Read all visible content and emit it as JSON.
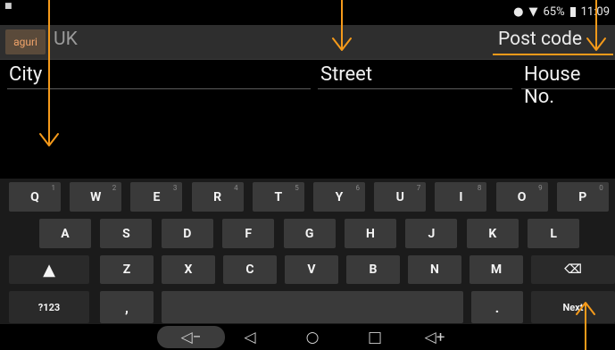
{
  "status": {
    "battery_percent": "65%",
    "time": "11:09"
  },
  "header": {
    "logo_text": "aguri",
    "country": "UK",
    "postcode_label": "Post code"
  },
  "fields": [
    {
      "label": "City"
    },
    {
      "label": "Street"
    },
    {
      "label": "House No."
    }
  ],
  "keyboard": {
    "row1": [
      {
        "label": "Q",
        "hint": "1"
      },
      {
        "label": "W",
        "hint": "2"
      },
      {
        "label": "E",
        "hint": "3"
      },
      {
        "label": "R",
        "hint": "4"
      },
      {
        "label": "T",
        "hint": "5"
      },
      {
        "label": "Y",
        "hint": "6"
      },
      {
        "label": "U",
        "hint": "7"
      },
      {
        "label": "I",
        "hint": "8"
      },
      {
        "label": "O",
        "hint": "9"
      },
      {
        "label": "P",
        "hint": "0"
      }
    ],
    "row2": [
      "A",
      "S",
      "D",
      "F",
      "G",
      "H",
      "J",
      "K",
      "L"
    ],
    "row3": [
      "Z",
      "X",
      "C",
      "V",
      "B",
      "N",
      "M"
    ],
    "symbols_label": "?123",
    "comma_label": ",",
    "period_label": ".",
    "next_label": "Next",
    "shift_icon": "shift-up-arrow-icon",
    "backspace_icon": "backspace-icon"
  },
  "navbar": {
    "icons": [
      "volume-down-icon",
      "back-icon",
      "home-icon",
      "recents-icon",
      "volume-up-icon"
    ]
  },
  "annotation_color": "#f59a1a"
}
